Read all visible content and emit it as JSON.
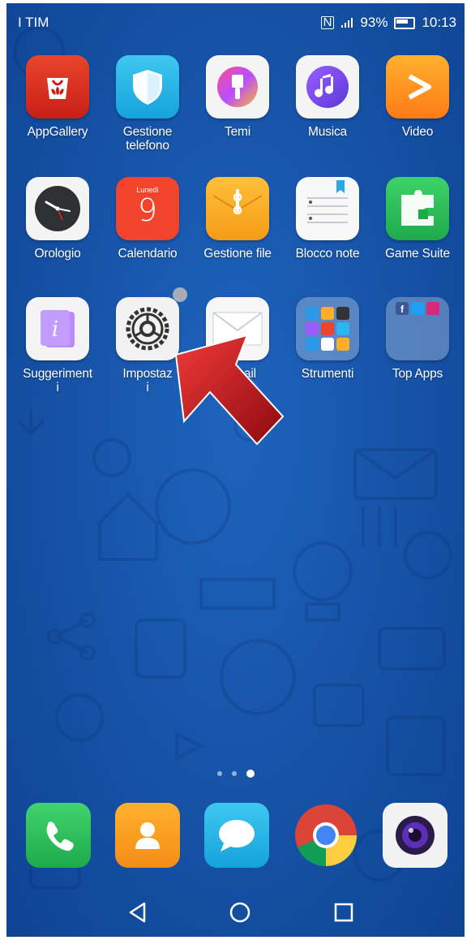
{
  "status_bar": {
    "carrier": "I TIM",
    "battery": "93%",
    "time": "10:13"
  },
  "apps": [
    {
      "label": "AppGallery",
      "icon": "appgallery-icon"
    },
    {
      "label": "Gestione\ntelefono",
      "icon": "shield-icon"
    },
    {
      "label": "Temi",
      "icon": "brush-icon"
    },
    {
      "label": "Musica",
      "icon": "music-note-icon"
    },
    {
      "label": "Video",
      "icon": "play-icon"
    },
    {
      "label": "Orologio",
      "icon": "clock-icon"
    },
    {
      "label": "Calendario",
      "icon": "calendar-icon"
    },
    {
      "label": "Gestione file",
      "icon": "folder-icon"
    },
    {
      "label": "Blocco note",
      "icon": "notepad-icon"
    },
    {
      "label": "Game Suite",
      "icon": "puzzle-icon"
    },
    {
      "label": "Suggeriment\ni",
      "icon": "info-icon"
    },
    {
      "label": "Impostaz\ni",
      "icon": "gear-icon"
    },
    {
      "label": "mail",
      "icon": "envelope-icon"
    },
    {
      "label": "Strumenti",
      "icon": "folder-grid-icon"
    },
    {
      "label": "Top Apps",
      "icon": "folder-grid-icon"
    }
  ],
  "calendar": {
    "day_name": "Lunedì",
    "day_number": "9"
  },
  "dock": [
    {
      "icon": "phone-icon"
    },
    {
      "icon": "contacts-icon"
    },
    {
      "icon": "messages-icon"
    },
    {
      "icon": "chrome-icon"
    },
    {
      "icon": "camera-icon"
    }
  ],
  "pager": {
    "pages": 3,
    "active": 3
  },
  "nav": {
    "back": "back-icon",
    "home": "home-icon",
    "recents": "recents-icon"
  },
  "colors": {
    "wallpaper": "#1755aa",
    "arrow": "#c8141e"
  }
}
